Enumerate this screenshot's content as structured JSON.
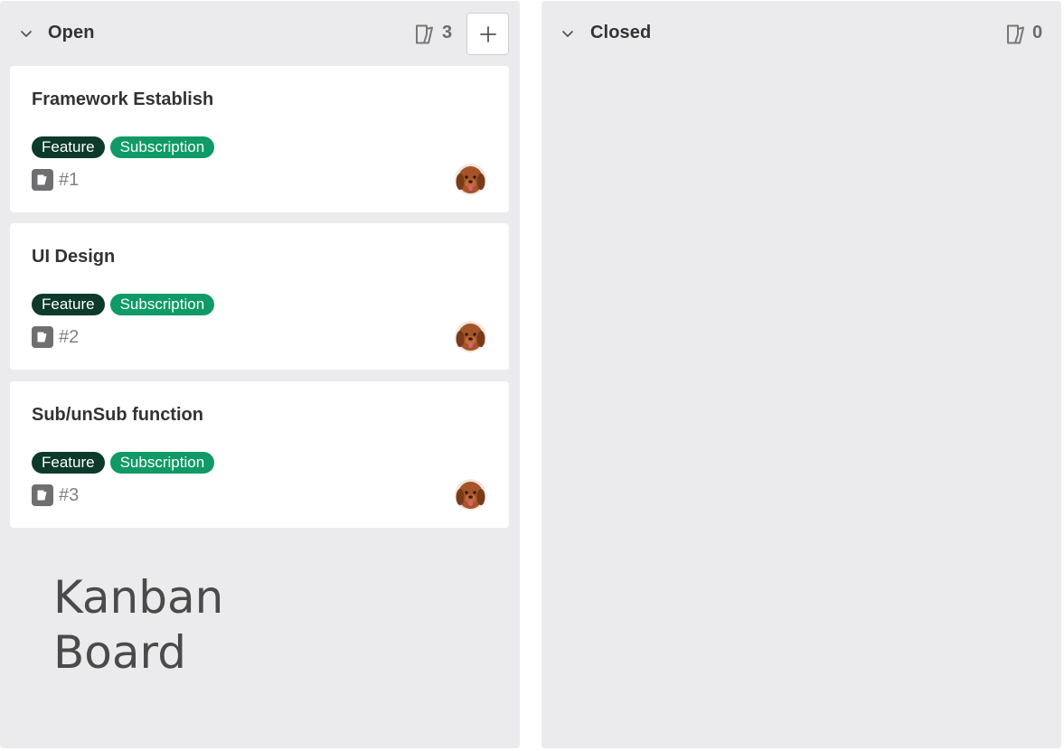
{
  "columns": {
    "open": {
      "title": "Open",
      "count": "3",
      "add_label": "+"
    },
    "closed": {
      "title": "Closed",
      "count": "0"
    }
  },
  "cards": [
    {
      "title": "Framework Establish",
      "tags": [
        "Feature",
        "Subscription"
      ],
      "number": "#1"
    },
    {
      "title": "UI Design",
      "tags": [
        "Feature",
        "Subscription"
      ],
      "number": "#2"
    },
    {
      "title": "Sub/unSub function",
      "tags": [
        "Feature",
        "Subscription"
      ],
      "number": "#3"
    }
  ],
  "caption": {
    "line1": "Kanban",
    "line2": "Board"
  },
  "colors": {
    "column_bg": "#ebebed",
    "tag_feature": "#0d3a2a",
    "tag_subscription": "#0f9a66",
    "issue_icon": "#6f6f72"
  },
  "icons": {
    "collapse": "chevron-down-icon",
    "count": "issue-count-icon",
    "add": "plus-icon",
    "issue": "issue-icon"
  }
}
